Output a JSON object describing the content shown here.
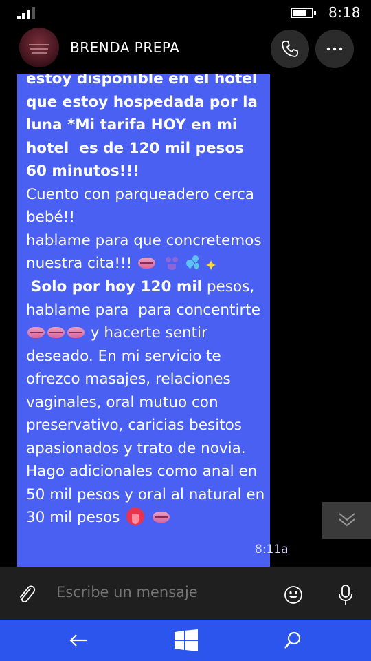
{
  "status_bar": {
    "time": "8:18",
    "battery_level": 0.7,
    "signal_bars": 3
  },
  "header": {
    "contact_name": "BRENDA PREPA",
    "call_icon": "phone-icon",
    "more_icon": "more-horizontal-icon"
  },
  "message": {
    "segments": [
      {
        "text": "estoy disponible en el hotel ",
        "bold": true
      },
      {
        "text": "que estoy hospedada por la luna *Mi tarifa HOY en mi hotel  es de 120 mil pesos 60 minutos!!!",
        "bold": true
      },
      {
        "text": "\nCuento con parqueadero cerca bebé!!\nhablame para que concretemos nuestra cita!!! ",
        "bold": false
      },
      {
        "emoji": "kiss-lips"
      },
      {
        "text": " ",
        "bold": false
      },
      {
        "emoji": "bikini"
      },
      {
        "emoji": "sweat-droplets"
      },
      {
        "emoji": "sparkles"
      },
      {
        "text": "\n ",
        "bold": false
      },
      {
        "text": "Solo por hoy 120 mil",
        "bold": true
      },
      {
        "text": " pesos, hablame para  para concentirte ",
        "bold": false
      },
      {
        "emoji": "kiss-lips"
      },
      {
        "emoji": "kiss-lips"
      },
      {
        "emoji": "kiss-lips"
      },
      {
        "text": " y hacerte sentir deseado. En mi servicio te ofrezco masajes, relaciones vaginales, oral mutuo con preservativo, caricias besitos apasionados y trato de novia. Hago adicionales como anal en 50 mil pesos y oral al natural en 30 mil pesos ",
        "bold": false
      },
      {
        "emoji": "tongue"
      },
      {
        "text": " ",
        "bold": false
      },
      {
        "emoji": "kiss-lips"
      }
    ],
    "timestamp": "8:11a",
    "bubble_color": "#4a60f2"
  },
  "scroll_button": {
    "icon": "chevron-double-down-icon"
  },
  "composer": {
    "placeholder": "Escribe un mensaje",
    "attach_icon": "paperclip-icon",
    "emoji_icon": "smiley-icon",
    "mic_icon": "microphone-icon"
  },
  "nav_bar": {
    "color": "#2c55ee",
    "back_icon": "back-arrow-icon",
    "home_icon": "windows-logo-icon",
    "search_icon": "search-icon"
  }
}
